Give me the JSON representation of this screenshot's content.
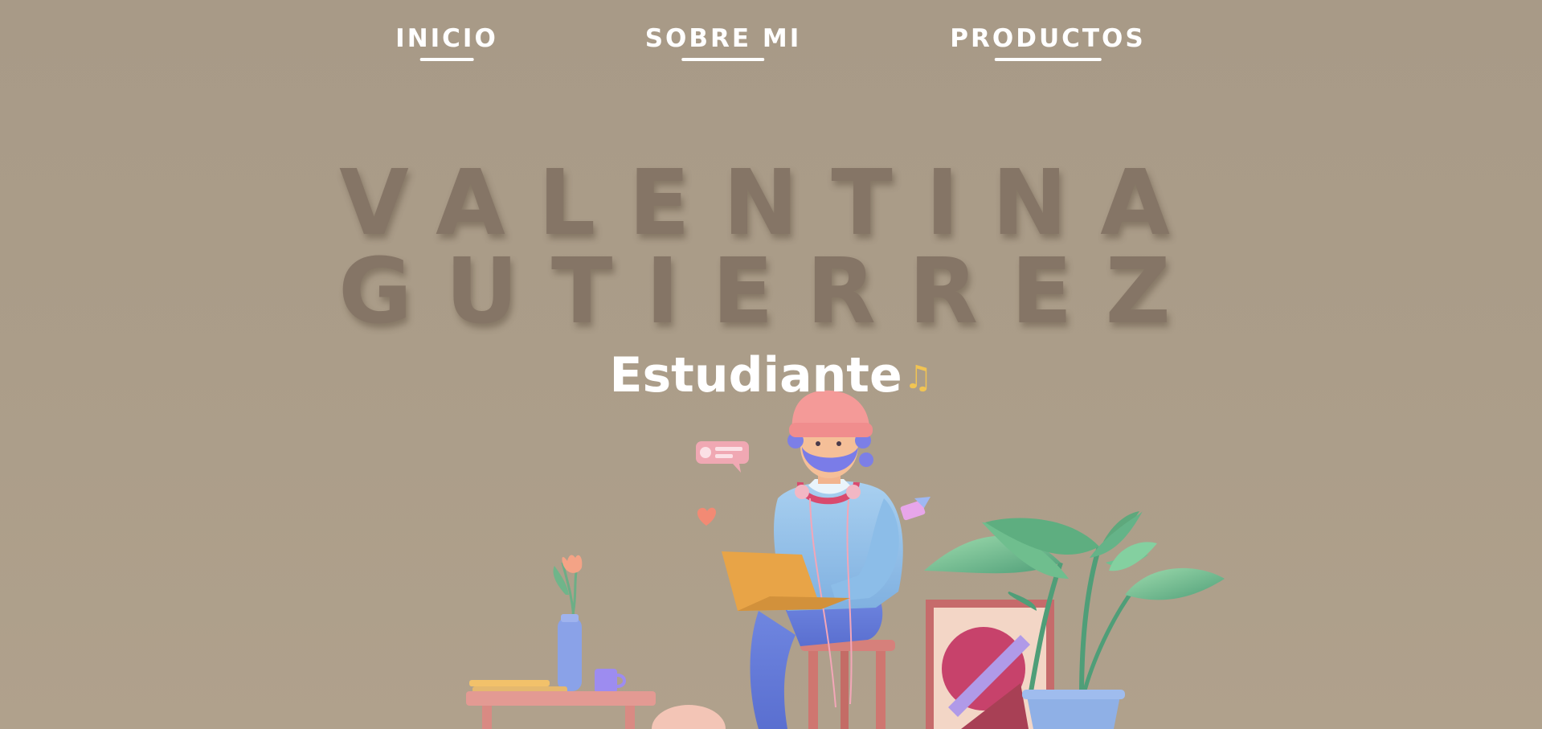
{
  "nav": {
    "items": [
      {
        "label": "INICIO"
      },
      {
        "label": "SOBRE MI"
      },
      {
        "label": "PRODUCTOS"
      }
    ]
  },
  "hero": {
    "name_line_1": "VALENTINA",
    "name_line_2": "GUTIERREZ",
    "subtitle": "Estudiante",
    "subtitle_icon": "♫"
  },
  "colors": {
    "background": "#a89a87",
    "title": "#857566",
    "nav_text": "#ffffff",
    "accent_note": "#f1c453"
  },
  "icons": {
    "subtitle_icon_name": "music-note-icon"
  }
}
